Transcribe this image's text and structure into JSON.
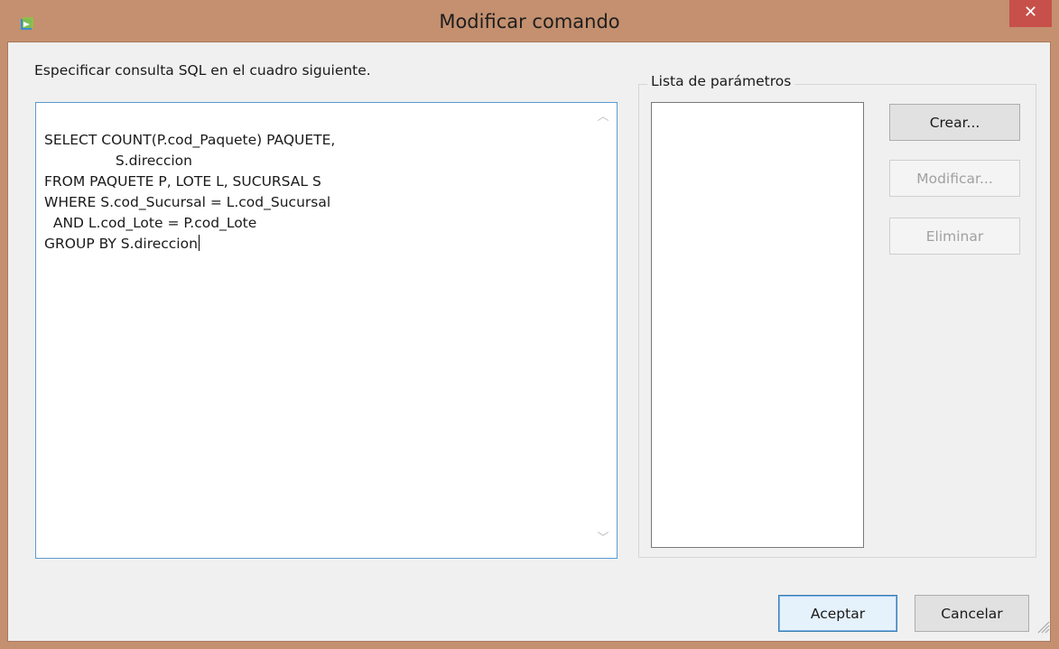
{
  "window": {
    "title": "Modificar comando",
    "close_label": "✕",
    "app_icon": "command-icon"
  },
  "instruction": "Especificar consulta SQL en el cuadro siguiente.",
  "sql_query": "SELECT COUNT(P.cod_Paquete) PAQUETE,\n                S.direccion\nFROM PAQUETE P, LOTE L, SUCURSAL S\nWHERE S.cod_Sucursal = L.cod_Sucursal\n  AND L.cod_Lote = P.cod_Lote\nGROUP BY S.direccion",
  "parameters": {
    "label": "Lista de parámetros",
    "items": []
  },
  "buttons": {
    "create": "Crear...",
    "modify": "Modificar...",
    "delete": "Eliminar",
    "ok": "Aceptar",
    "cancel": "Cancelar"
  },
  "colors": {
    "titlebar": "#c4906f",
    "close_button": "#c7504a",
    "focus_border": "#5b9bd5"
  }
}
